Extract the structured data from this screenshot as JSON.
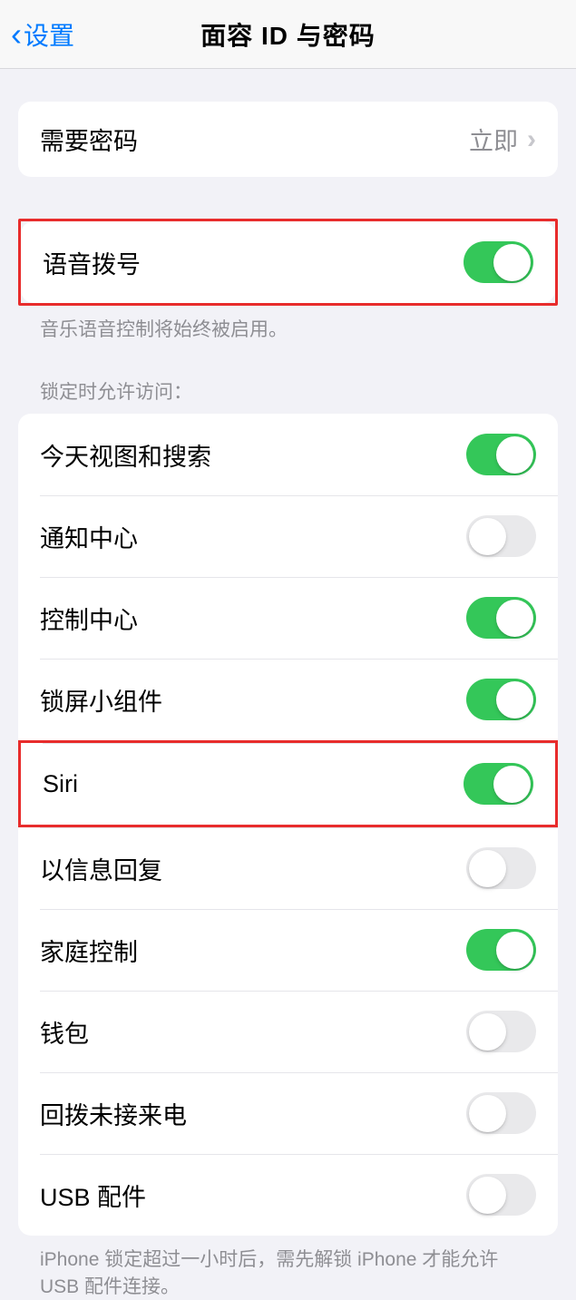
{
  "nav": {
    "back_label": "设置",
    "title": "面容 ID 与密码"
  },
  "group1": {
    "require_passcode": {
      "label": "需要密码",
      "value": "立即"
    }
  },
  "group2": {
    "voice_dial": {
      "label": "语音拨号",
      "on": true
    },
    "footer": "音乐语音控制将始终被启用。"
  },
  "section_header": "锁定时允许访问：",
  "group3": {
    "items": [
      {
        "label": "今天视图和搜索",
        "on": true
      },
      {
        "label": "通知中心",
        "on": false
      },
      {
        "label": "控制中心",
        "on": true
      },
      {
        "label": "锁屏小组件",
        "on": true
      },
      {
        "label": "Siri",
        "on": true
      },
      {
        "label": "以信息回复",
        "on": false
      },
      {
        "label": "家庭控制",
        "on": true
      },
      {
        "label": "钱包",
        "on": false
      },
      {
        "label": "回拨未接来电",
        "on": false
      },
      {
        "label": "USB 配件",
        "on": false
      }
    ],
    "footer": "iPhone 锁定超过一小时后，需先解锁 iPhone 才能允许 USB 配件连接。"
  }
}
